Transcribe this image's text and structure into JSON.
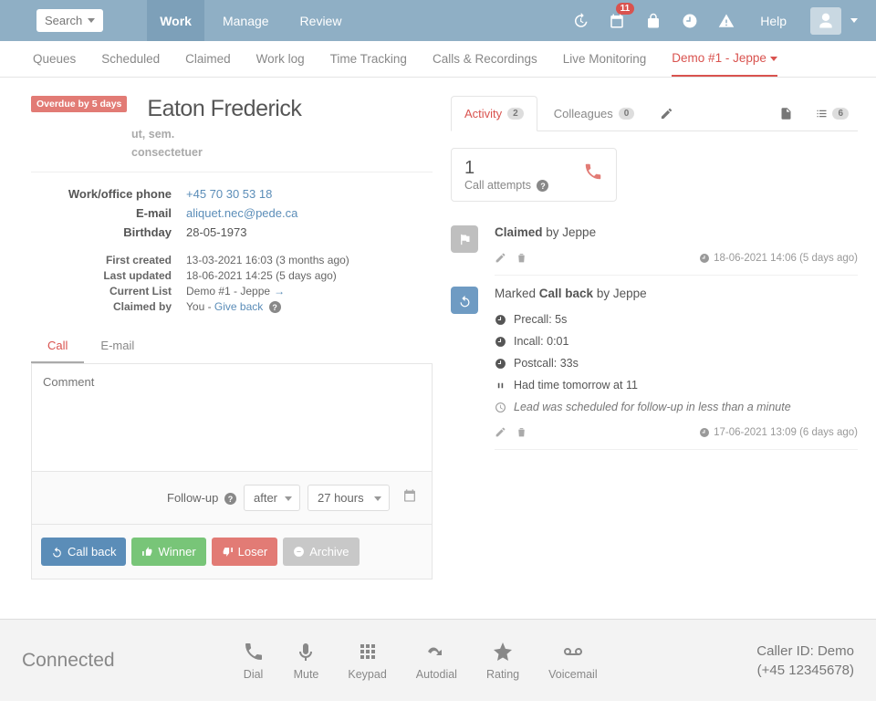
{
  "topbar": {
    "search_label": "Search",
    "nav": [
      "Work",
      "Manage",
      "Review"
    ],
    "active_nav": "Work",
    "calendar_badge": "11",
    "help": "Help"
  },
  "subnav": {
    "tabs": [
      "Queues",
      "Scheduled",
      "Claimed",
      "Work log",
      "Time Tracking",
      "Calls & Recordings",
      "Live Monitoring"
    ],
    "active_tab": "Demo #1 - Jeppe"
  },
  "lead": {
    "overdue": "Overdue by 5 days",
    "name": "Eaton Frederick",
    "sub1": "ut, sem.",
    "sub2": "consectetuer",
    "fields": {
      "phone_label": "Work/office phone",
      "phone": "+45 70 30 53 18",
      "email_label": "E-mail",
      "email": "aliquet.nec@pede.ca",
      "birthday_label": "Birthday",
      "birthday": "28-05-1973",
      "first_created_label": "First created",
      "first_created": "13-03-2021 16:03 (3 months ago)",
      "last_updated_label": "Last updated",
      "last_updated": "18-06-2021 14:25 (5 days ago)",
      "current_list_label": "Current List",
      "current_list": "Demo #1 - Jeppe",
      "claimed_by_label": "Claimed by",
      "claimed_by_prefix": "You - ",
      "give_back": "Give back"
    }
  },
  "comment": {
    "tabs": [
      "Call",
      "E-mail"
    ],
    "active": "Call",
    "placeholder": "Comment",
    "followup_label": "Follow-up",
    "mode": "after",
    "duration": "27 hours"
  },
  "actions": {
    "callback": "Call back",
    "winner": "Winner",
    "loser": "Loser",
    "archive": "Archive"
  },
  "right_tabs": {
    "activity": "Activity",
    "activity_count": "2",
    "colleagues": "Colleagues",
    "colleagues_count": "0",
    "list_count": "6"
  },
  "call_attempts": {
    "count": "1",
    "label": "Call attempts"
  },
  "timeline": [
    {
      "type": "claimed",
      "title_action": "Claimed",
      "title_suffix": " by Jeppe",
      "timestamp": "18-06-2021 14:06 (5 days ago)"
    },
    {
      "type": "callback",
      "title_prefix": "Marked ",
      "title_bold": "Call back",
      "title_suffix": " by Jeppe",
      "precall": "Precall: 5s",
      "incall": "Incall: 0:01",
      "postcall": "Postcall: 33s",
      "comment": "Had time tomorrow at 11",
      "schedule_note": "Lead was scheduled for follow-up in less than a minute",
      "timestamp": "17-06-2021 13:09 (6 days ago)"
    }
  ],
  "footer": {
    "status": "Connected",
    "tools": [
      "Dial",
      "Mute",
      "Keypad",
      "Autodial",
      "Rating",
      "Voicemail"
    ],
    "caller_id_line1": "Caller ID: Demo",
    "caller_id_line2": "(+45 12345678)"
  }
}
